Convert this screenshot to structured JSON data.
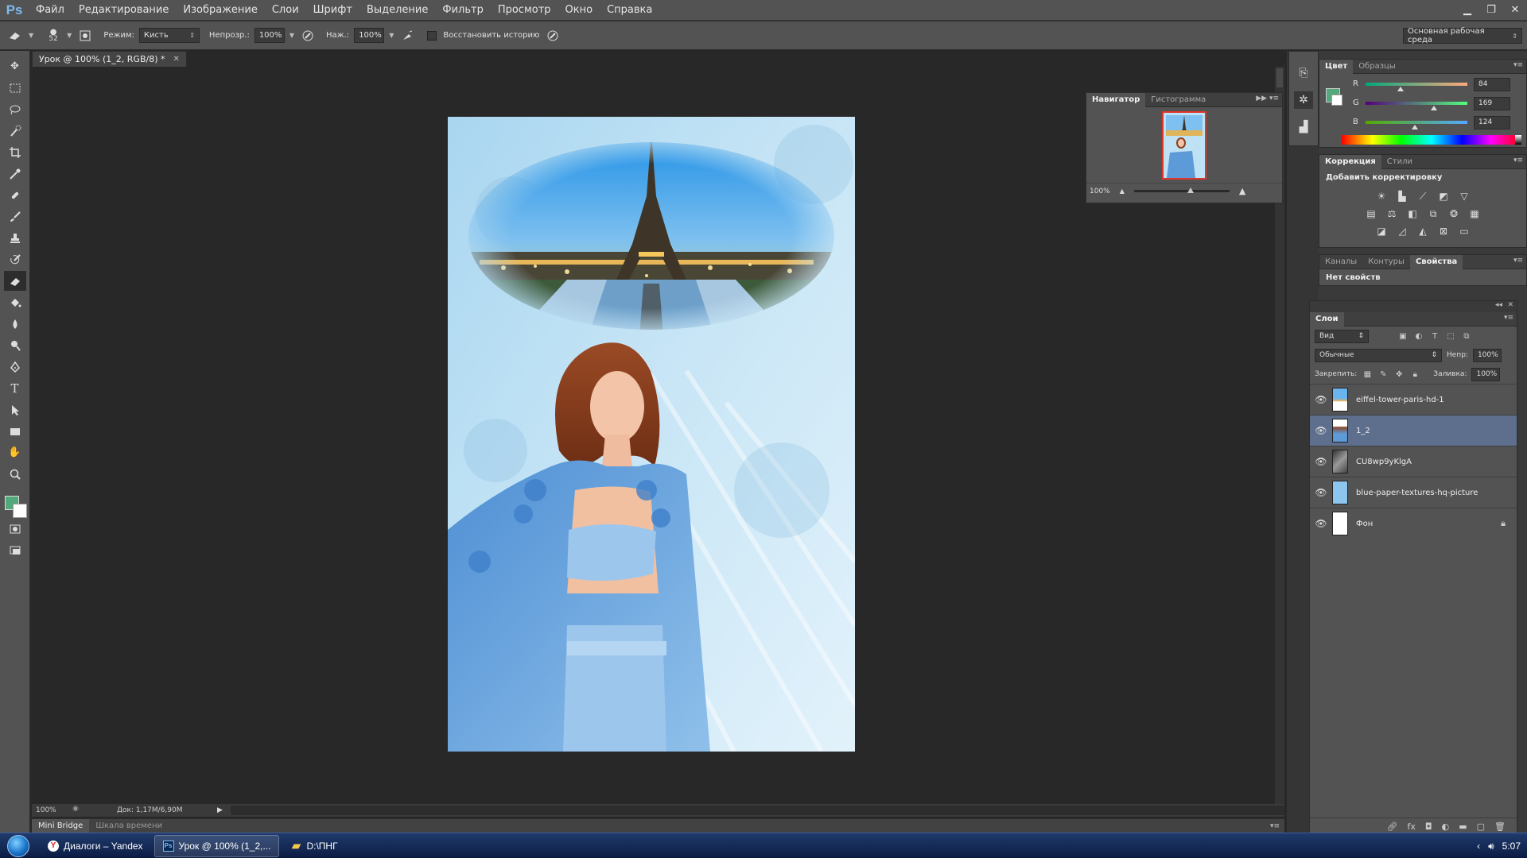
{
  "app": {
    "logo": "Ps"
  },
  "menu": [
    "Файл",
    "Редактирование",
    "Изображение",
    "Слои",
    "Шрифт",
    "Выделение",
    "Фильтр",
    "Просмотр",
    "Окно",
    "Справка"
  ],
  "window_controls": {
    "minimize_icon": "minimize-icon",
    "restore_icon": "restore-icon",
    "close_icon": "close-icon"
  },
  "options": {
    "brush_size": "52",
    "mode_label": "Режим:",
    "mode_value": "Кисть",
    "opacity_label": "Непрозр.:",
    "opacity_value": "100%",
    "pressure_label": "Наж.:",
    "pressure_value": "100%",
    "restore_history_label": "Восстановить историю",
    "workspace_value": "Основная рабочая среда"
  },
  "document": {
    "tab_title": "Урок @ 100% (1_2, RGB/8) *",
    "zoom": "100%",
    "doc_info": "Док: 1,17M/6,90M"
  },
  "bottom_panel": {
    "tabs": [
      "Mini Bridge",
      "Шкала времени"
    ]
  },
  "navigator": {
    "tabs": [
      "Навигатор",
      "Гистограмма"
    ],
    "zoom": "100%"
  },
  "color_panel": {
    "tabs": [
      "Цвет",
      "Образцы"
    ],
    "r": {
      "label": "R",
      "value": "84"
    },
    "g": {
      "label": "G",
      "value": "169"
    },
    "b": {
      "label": "B",
      "value": "124"
    },
    "foreground_color": "#54a97c"
  },
  "adjustments": {
    "tabs": [
      "Коррекция",
      "Стили"
    ],
    "title": "Добавить корректировку"
  },
  "properties": {
    "tabs": [
      "Каналы",
      "Контуры",
      "Свойства"
    ],
    "text": "Нет свойств"
  },
  "layers": {
    "title": "Слои",
    "filter_value": "Вид",
    "blend_mode": "Обычные",
    "opacity_label": "Непр:",
    "opacity_value": "100%",
    "lock_label": "Закрепить:",
    "fill_label": "Заливка:",
    "fill_value": "100%",
    "items": [
      {
        "name": "eiffel-tower-paris-hd-1",
        "selected": false,
        "locked": false
      },
      {
        "name": "1_2",
        "selected": true,
        "locked": false
      },
      {
        "name": "CU8wp9yKlgA",
        "selected": false,
        "locked": false
      },
      {
        "name": "blue-paper-textures-hq-picture",
        "selected": false,
        "locked": false
      },
      {
        "name": "Фон",
        "selected": false,
        "locked": true
      }
    ]
  },
  "taskbar": {
    "items": [
      {
        "label": "Диалоги – Yandex",
        "icon": "Y"
      },
      {
        "label": "Урок @ 100% (1_2,...",
        "icon": "Ps"
      },
      {
        "label": "D:\\ПНГ",
        "icon": "folder"
      }
    ],
    "clock": "5:07"
  }
}
